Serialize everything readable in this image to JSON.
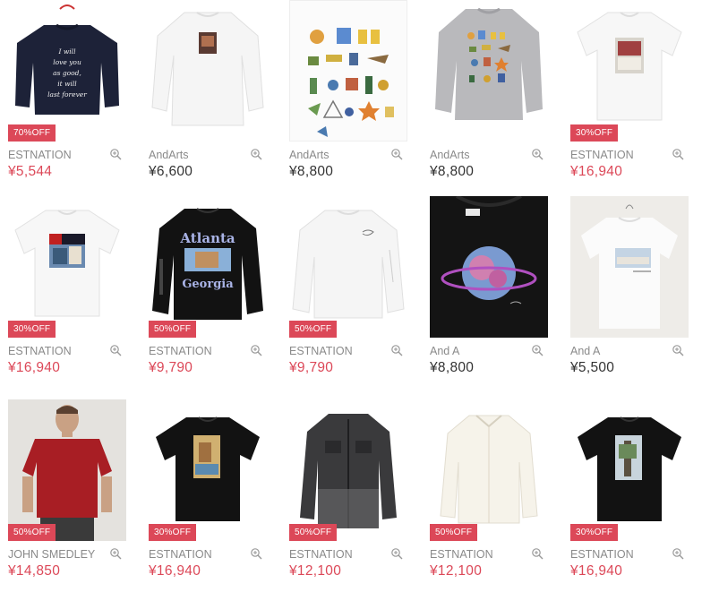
{
  "products": [
    {
      "brand": "ESTNATION",
      "price": "¥5,544",
      "badge": "70%OFF",
      "sale": true,
      "image": "navy-sweatshirt-script-print"
    },
    {
      "brand": "AndArts",
      "price": "¥6,600",
      "badge": "",
      "sale": false,
      "image": "white-longsleeve-photo-pocket"
    },
    {
      "brand": "AndArts",
      "price": "¥8,800",
      "badge": "",
      "sale": false,
      "image": "white-illustration-print-closeup"
    },
    {
      "brand": "AndArts",
      "price": "¥8,800",
      "badge": "",
      "sale": false,
      "image": "grey-sweatshirt-illustrations"
    },
    {
      "brand": "ESTNATION",
      "price": "¥16,940",
      "badge": "30%OFF",
      "sale": true,
      "image": "white-tee-photo-print"
    },
    {
      "brand": "ESTNATION",
      "price": "¥16,940",
      "badge": "30%OFF",
      "sale": true,
      "image": "white-tee-flag-photo-print"
    },
    {
      "brand": "ESTNATION",
      "price": "¥9,790",
      "badge": "50%OFF",
      "sale": true,
      "image": "black-longsleeve-atlanta-georgia"
    },
    {
      "brand": "ESTNATION",
      "price": "¥9,790",
      "badge": "50%OFF",
      "sale": true,
      "image": "white-sweatshirt-small-logo"
    },
    {
      "brand": "And A",
      "price": "¥8,800",
      "badge": "",
      "sale": false,
      "image": "black-tee-planet-art"
    },
    {
      "brand": "And A",
      "price": "¥5,500",
      "badge": "",
      "sale": false,
      "image": "white-tee-hanger-photo"
    },
    {
      "brand": "JOHN SMEDLEY",
      "price": "¥14,850",
      "badge": "50%OFF",
      "sale": true,
      "image": "model-red-knit-tee"
    },
    {
      "brand": "ESTNATION",
      "price": "¥16,940",
      "badge": "30%OFF",
      "sale": true,
      "image": "black-tee-photo-print"
    },
    {
      "brand": "ESTNATION",
      "price": "¥12,100",
      "badge": "50%OFF",
      "sale": true,
      "image": "black-denim-jacket"
    },
    {
      "brand": "ESTNATION",
      "price": "¥12,100",
      "badge": "50%OFF",
      "sale": true,
      "image": "white-shirt"
    },
    {
      "brand": "ESTNATION",
      "price": "¥16,940",
      "badge": "30%OFF",
      "sale": true,
      "image": "black-tee-tree-photo"
    }
  ],
  "artwork": {
    "sweatshirt_script": "I will love you as good, it will last forever",
    "atlanta": "Atlanta",
    "georgia": "Georgia"
  },
  "icons": {
    "zoom": "zoom-icon"
  },
  "colors": {
    "sale": "#dc4858",
    "brand_text": "#8a8a8a",
    "price_text": "#333333"
  }
}
